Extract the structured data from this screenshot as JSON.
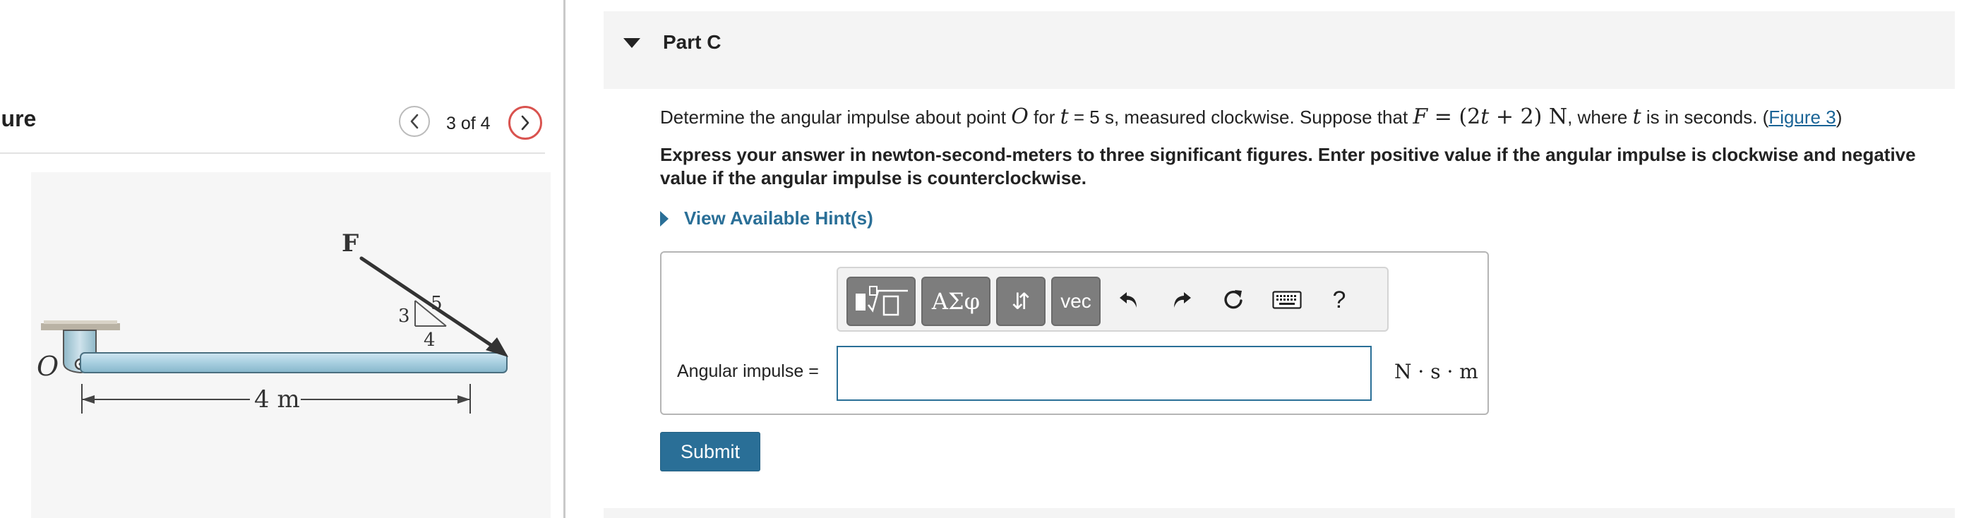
{
  "figure_panel": {
    "title": "gure",
    "counter": "3 of 4",
    "prev_icon": "chevron-left-icon",
    "next_icon": "chevron-right-icon",
    "diagram": {
      "force_label": "F",
      "point_label": "O",
      "slope_rise": "3",
      "slope_hyp": "5",
      "slope_run": "4",
      "dimension": "4 m"
    }
  },
  "part": {
    "title": "Part C",
    "collapse_icon": "caret-down-icon"
  },
  "question": {
    "t1": "Determine the angular impulse about point ",
    "point": "O",
    "t2": " for ",
    "tvar": "t",
    "t3": " = 5 s, measured clockwise. Suppose that ",
    "F": "F",
    "eq": " = (2",
    "tvar2": "t",
    "eq2": " + 2) N",
    "t4": ", where ",
    "tvar3": "t",
    "t5": " is in seconds. (",
    "link": "Figure 3",
    "t6": ")"
  },
  "instruction": "Express your answer in newton-second-meters to three significant figures. Enter positive value if the angular impulse is clockwise and negative value if the angular impulse is counterclockwise.",
  "hints": {
    "label": "View Available Hint(s)",
    "icon": "caret-right-icon"
  },
  "toolbar": {
    "greek_label": "ΑΣφ",
    "arrows_label": "⇵",
    "vec_label": "vec",
    "help_label": "?"
  },
  "answer": {
    "label": "Angular impulse =",
    "value": "",
    "units": "N · s · m"
  },
  "submit_label": "Submit",
  "colors": {
    "link": "#1a6496",
    "primary": "#2a6f97",
    "next_ring": "#d9534f",
    "beam": "#a8cfe0",
    "toolbar_button": "#7d7d7d"
  }
}
